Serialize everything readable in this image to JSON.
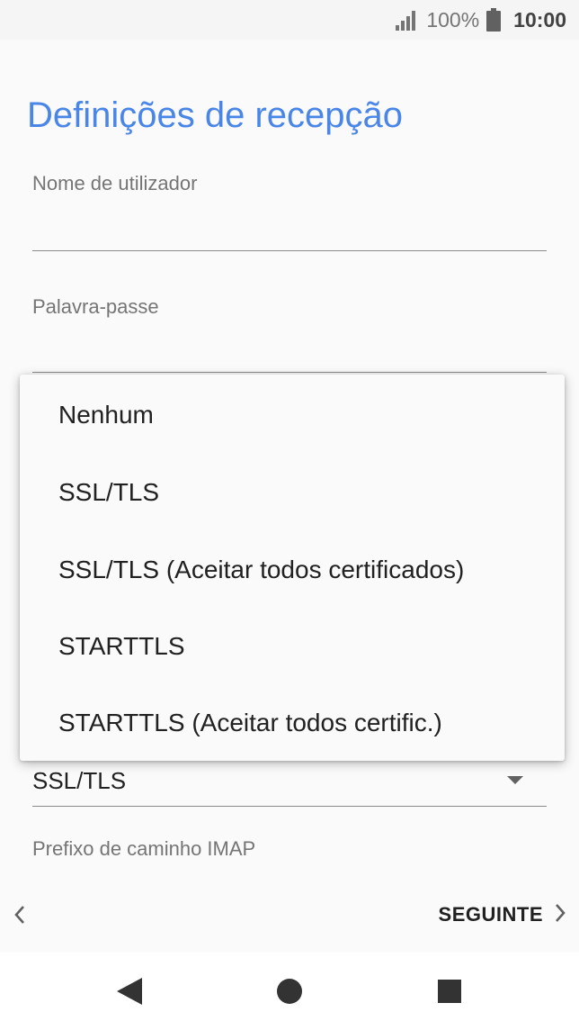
{
  "status_bar": {
    "battery_percent": "100%",
    "time": "10:00",
    "icons": [
      "signal-icon",
      "battery-icon"
    ]
  },
  "page": {
    "title": "Definições de recepção"
  },
  "form": {
    "username_label": "Nome de utilizador",
    "username_value": "",
    "password_label": "Palavra-passe",
    "security_value": "SSL/TLS",
    "imap_prefix_label": "Prefixo de caminho IMAP"
  },
  "security_menu": {
    "options": [
      "Nenhum",
      "SSL/TLS",
      "SSL/TLS (Aceitar todos certificados)",
      "STARTTLS",
      "STARTTLS (Aceitar todos certific.)"
    ]
  },
  "navigation": {
    "next_label": "SEGUINTE",
    "icons": [
      "chevron-left-icon",
      "chevron-right-icon"
    ]
  },
  "system_nav": {
    "icons": [
      "back-triangle-icon",
      "home-circle-icon",
      "recents-square-icon"
    ]
  },
  "colors": {
    "title_blue": "#4a86e8",
    "background": "#fafafa",
    "text": "#212121",
    "label_gray": "#757575"
  }
}
